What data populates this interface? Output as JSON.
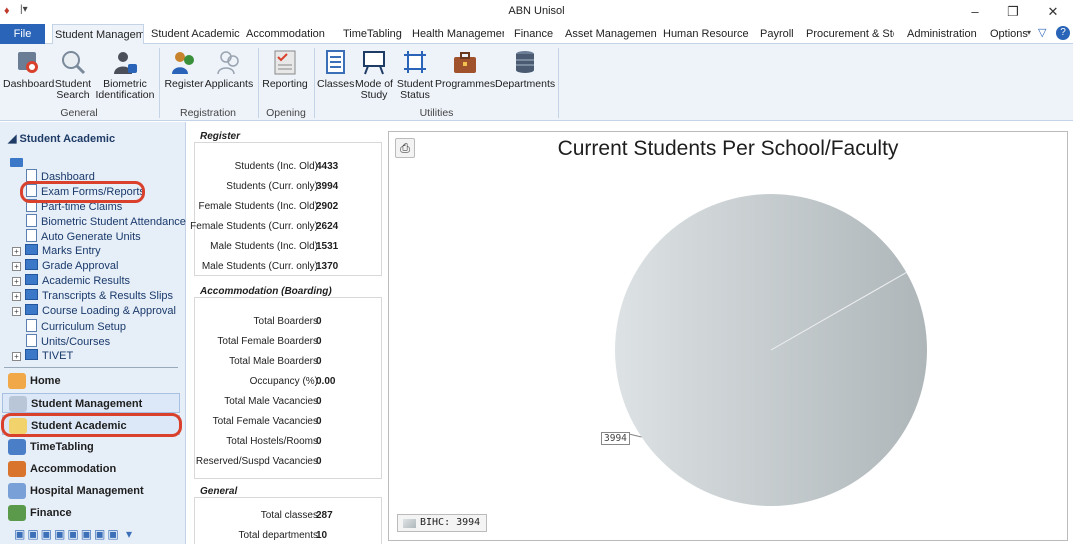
{
  "window": {
    "title": "ABN Unisol"
  },
  "tabs": {
    "file": "File",
    "items": [
      "Student Manageme",
      "Student Academic",
      "Accommodation",
      "TimeTabling",
      "Health Managemer",
      "Finance",
      "Asset Management",
      "Human Resource",
      "Payroll",
      "Procurement & Sto",
      "Administration"
    ],
    "options": "Options"
  },
  "ribbon": {
    "buttons": {
      "dashboard": "Dashboard",
      "student_search": "Student Search",
      "biometric_identification": "Biometric Identification",
      "register": "Register",
      "applicants": "Applicants",
      "reporting": "Reporting",
      "classes": "Classes",
      "mode_of_study": "Mode of Study",
      "student_status": "Student Status",
      "programmes": "Programmes",
      "departments": "Departments"
    },
    "groups": {
      "general": "General",
      "registration": "Registration",
      "opening": "Opening",
      "utilities": "Utilities"
    }
  },
  "leftnav": {
    "header": "Student Academic",
    "tree": [
      "Dashboard",
      "Exam Forms/Reports",
      "Part-time Claims",
      "Biometric Student Attendance",
      "Auto Generate Units",
      "Marks Entry",
      "Grade Approval",
      "Academic Results",
      "Transcripts & Results Slips",
      "Course Loading & Approval",
      "Curriculum Setup",
      "Units/Courses",
      "TIVET"
    ],
    "modules": [
      "Home",
      "Student Management",
      "Student Academic",
      "TimeTabling",
      "Accommodation",
      "Hospital Management",
      "Finance"
    ]
  },
  "register": {
    "title": "Register",
    "rows": [
      {
        "label": "Students (Inc. Old)",
        "value": "4433"
      },
      {
        "label": "Students (Curr. only)",
        "value": "3994"
      },
      {
        "label": "Female Students (Inc. Old)",
        "value": "2902"
      },
      {
        "label": "Female Students (Curr. only)",
        "value": "2624"
      },
      {
        "label": "Male Students (Inc. Old)",
        "value": "1531"
      },
      {
        "label": "Male Students (Curr. only)",
        "value": "1370"
      }
    ]
  },
  "accommodation": {
    "title": "Accommodation (Boarding)",
    "rows": [
      {
        "label": "Total Boarders",
        "value": "0"
      },
      {
        "label": "Total Female Boarders",
        "value": "0"
      },
      {
        "label": "Total Male Boarders",
        "value": "0"
      },
      {
        "label": "Occupancy (%)",
        "value": "0.00"
      },
      {
        "label": "Total Male Vacancies",
        "value": "0"
      },
      {
        "label": "Total Female Vacancies",
        "value": "0"
      },
      {
        "label": "Total Hostels/Rooms",
        "value": "0"
      },
      {
        "label": "Reserved/Suspd Vacancies",
        "value": "0"
      }
    ]
  },
  "general": {
    "title": "General",
    "rows": [
      {
        "label": "Total classes",
        "value": "287"
      },
      {
        "label": "Total departments",
        "value": "10"
      }
    ]
  },
  "chart_data": {
    "type": "pie",
    "title": "Current Students Per School/Faculty",
    "categories": [
      "BIHC"
    ],
    "values": [
      3994
    ],
    "data_labels": [
      "3994"
    ],
    "legend": [
      "BIHC: 3994"
    ],
    "legend_position": "bottom-left"
  },
  "colors": {
    "accent": "#2a64b8",
    "highlight": "#d9412c",
    "pie": "#c4cbcd"
  }
}
